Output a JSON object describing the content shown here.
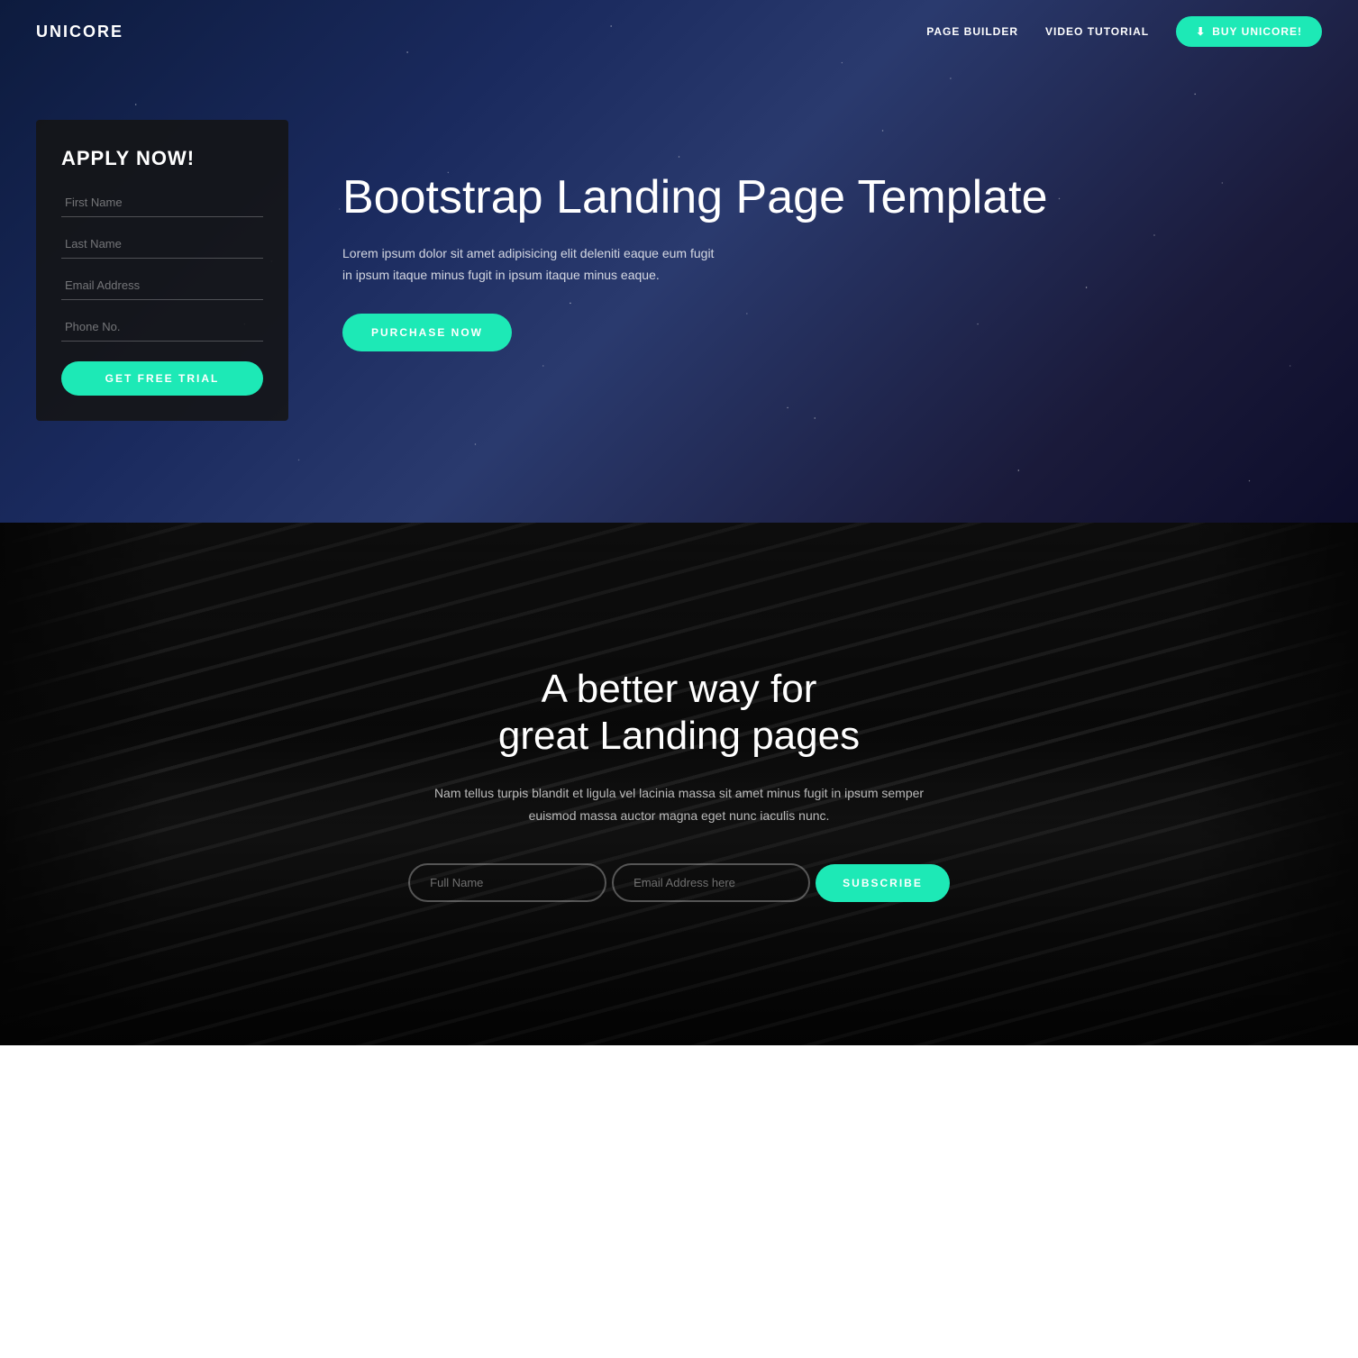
{
  "brand": "UNICORE",
  "navbar": {
    "links": [
      {
        "label": "PAGE BUILDER",
        "id": "page-builder"
      },
      {
        "label": "VIDEO TUTORIAL",
        "id": "video-tutorial"
      }
    ],
    "cta": {
      "label": "BUY UNICORE!",
      "icon": "download-icon"
    }
  },
  "hero": {
    "form": {
      "title": "APPLY NOW!",
      "fields": [
        {
          "placeholder": "First Name",
          "id": "first-name",
          "type": "text"
        },
        {
          "placeholder": "Last Name",
          "id": "last-name",
          "type": "text"
        },
        {
          "placeholder": "Email Address",
          "id": "email",
          "type": "email"
        },
        {
          "placeholder": "Phone No.",
          "id": "phone",
          "type": "tel"
        }
      ],
      "submit_label": "GET FREE TRIAL"
    },
    "headline": "Bootstrap Landing Page Template",
    "body": "Lorem ipsum dolor sit amet adipisicing elit deleniti eaque eum fugit in ipsum itaque minus fugit in ipsum itaque minus eaque.",
    "cta_label": "PURCHASE NOW"
  },
  "section2": {
    "headline_line1": "A better way for",
    "headline_line2": "great Landing pages",
    "body": "Nam tellus turpis blandit et ligula vel lacinia massa sit amet minus fugit in ipsum semper euismod massa auctor magna eget nunc iaculis nunc.",
    "subscribe": {
      "fullname_placeholder": "Full Name",
      "email_placeholder": "Email Address here",
      "button_label": "SUBSCRIBE"
    }
  },
  "colors": {
    "accent": "#1de9b6",
    "dark_bg": "#111111",
    "card_bg": "rgba(20,20,20,0.88)"
  }
}
